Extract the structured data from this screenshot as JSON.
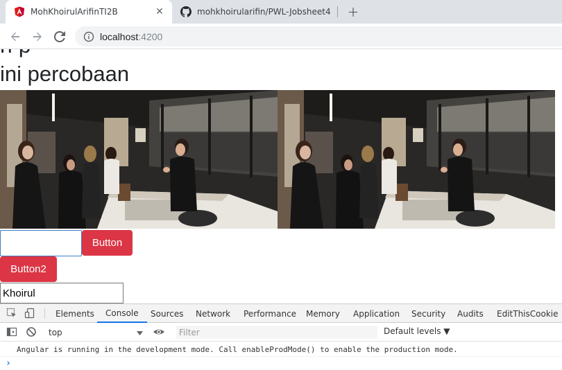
{
  "browser": {
    "tabs": [
      {
        "title": "MohKhoirulArifinTI2B",
        "icon": "angular-icon",
        "active": true
      },
      {
        "title": "mohkhoirularifin/PWL-Jobsheet4",
        "icon": "github-icon",
        "active": false
      }
    ],
    "close_glyph": "✕",
    "new_tab_glyph": "+",
    "url_host": "localhost",
    "url_port": ":4200"
  },
  "page": {
    "clipped_heading": "h p",
    "heading": "ini percobaan",
    "input1_value": "",
    "button1_label": "Button",
    "button2_label": "Button2",
    "input2_value": "Khoirul",
    "button_color": "#dc3545"
  },
  "devtools": {
    "tabs": [
      "Elements",
      "Console",
      "Sources",
      "Network",
      "Performance",
      "Memory",
      "Application",
      "Security",
      "Audits",
      "EditThisCookie"
    ],
    "active_tab": "Console",
    "context": "top",
    "filter_placeholder": "Filter",
    "levels": "Default levels ▼",
    "message": "Angular is running in the development mode. Call enableProdMode() to enable the production mode.",
    "prompt": "›"
  }
}
